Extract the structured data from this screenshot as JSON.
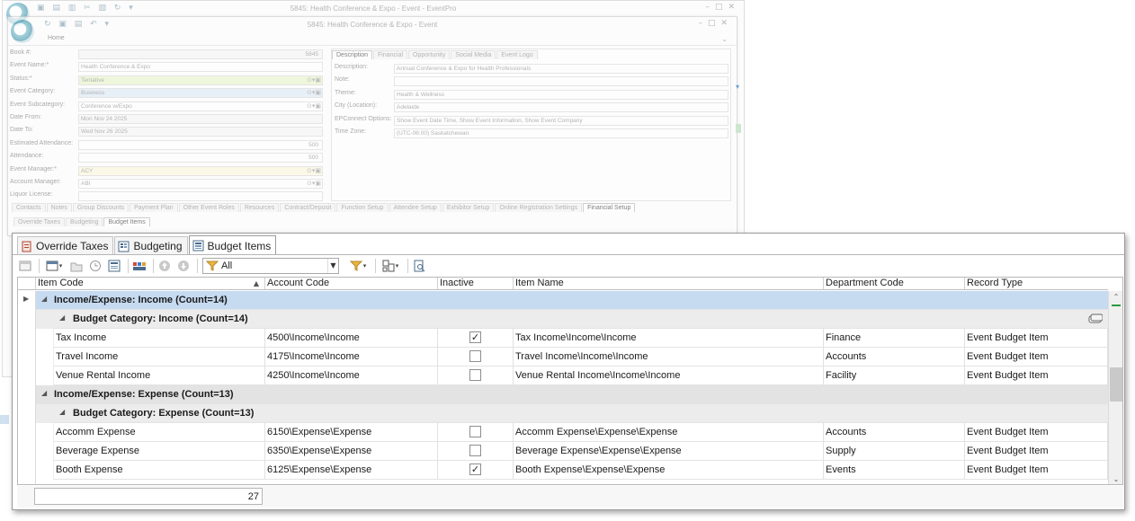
{
  "outer_window": {
    "title": "5845: Health Conference & Expo - Event - EventPro"
  },
  "inner_window": {
    "title": "5845: Health Conference & Expo - Event",
    "home_tab": "Home",
    "fields": [
      {
        "label": "Book #:",
        "value": "5845",
        "style": "ro"
      },
      {
        "label": "Event Name:*",
        "value": "Health Conference & Expo",
        "style": ""
      },
      {
        "label": "Status:*",
        "value": "Tentative",
        "style": "req"
      },
      {
        "label": "Event Category:",
        "value": "Business",
        "style": "blue"
      },
      {
        "label": "Event Subcategory:",
        "value": "Conference w/Expo",
        "style": ""
      },
      {
        "label": "Date From:",
        "value": "Mon Nov 24 2025",
        "style": "ro"
      },
      {
        "label": "Date To:",
        "value": "Wed Nov 26 2025",
        "style": "ro"
      },
      {
        "label": "Estimated Attendance:",
        "value": "500",
        "style": ""
      },
      {
        "label": "Attendance:",
        "value": "500",
        "style": ""
      },
      {
        "label": "Event Manager:*",
        "value": "ACY",
        "style": "yel"
      },
      {
        "label": "Account Manager:",
        "value": "ABI",
        "style": ""
      },
      {
        "label": "Liquor License:",
        "value": "",
        "style": ""
      }
    ],
    "desc_tabs": [
      "Description",
      "Financial",
      "Opportunity",
      "Social Media",
      "Event Logo"
    ],
    "desc_fields": [
      {
        "label": "Description:",
        "value": "Annual Conference & Expo for Health Professionals"
      },
      {
        "label": "Note:",
        "value": ""
      },
      {
        "label": "Theme:",
        "value": "Health & Wellness"
      },
      {
        "label": "City (Location):",
        "value": "Adelaide"
      },
      {
        "label": "EPConnect Options:",
        "value": "Show Event Date Time, Show Event Information, Show Event Company"
      },
      {
        "label": "Time Zone:",
        "value": "(UTC-06:00) Saskatchewan"
      }
    ],
    "bottom_tabs": [
      "Contacts",
      "Notes",
      "Group Discounts",
      "Payment Plan",
      "Other Event Roles",
      "Resources",
      "Contract/Deposit",
      "Function Setup",
      "Attendee Setup",
      "Exhibitor Setup",
      "Online Registration Settings",
      "Financial Setup"
    ],
    "sub_tabs": [
      "Override Taxes",
      "Budgeting",
      "Budget Items"
    ]
  },
  "panel": {
    "tabs": [
      {
        "label": "Override Taxes",
        "active": false
      },
      {
        "label": "Budgeting",
        "active": false
      },
      {
        "label": "Budget Items",
        "active": true
      }
    ],
    "filter_value": "All",
    "columns": [
      "Item Code",
      "Account Code",
      "Inactive",
      "Item Name",
      "Department Code",
      "Record Type"
    ],
    "groups": [
      {
        "label": "Income/Expense: Income (Count=14)",
        "category": "Budget Category: Income (Count=14)",
        "rows": [
          {
            "item_code": "Tax Income",
            "account_code": "4500\\Income\\Income",
            "inactive": true,
            "item_name": "Tax Income\\Income\\Income",
            "department_code": "Finance",
            "record_type": "Event Budget Item"
          },
          {
            "item_code": "Travel Income",
            "account_code": "4175\\Income\\Income",
            "inactive": false,
            "item_name": "Travel Income\\Income\\Income",
            "department_code": "Accounts",
            "record_type": "Event Budget Item"
          },
          {
            "item_code": "Venue Rental Income",
            "account_code": "4250\\Income\\Income",
            "inactive": false,
            "item_name": "Venue Rental Income\\Income\\Income",
            "department_code": "Facility",
            "record_type": "Event Budget Item"
          }
        ]
      },
      {
        "label": "Income/Expense: Expense (Count=13)",
        "category": "Budget Category: Expense (Count=13)",
        "rows": [
          {
            "item_code": "Accomm Expense",
            "account_code": "6150\\Expense\\Expense",
            "inactive": false,
            "item_name": "Accomm Expense\\Expense\\Expense",
            "department_code": "Accounts",
            "record_type": "Event Budget Item"
          },
          {
            "item_code": "Beverage Expense",
            "account_code": "6350\\Expense\\Expense",
            "inactive": false,
            "item_name": "Beverage Expense\\Expense\\Expense",
            "department_code": "Supply",
            "record_type": "Event Budget Item"
          },
          {
            "item_code": "Booth Expense",
            "account_code": "6125\\Expense\\Expense",
            "inactive": true,
            "item_name": "Booth Expense\\Expense\\Expense",
            "department_code": "Events",
            "record_type": "Event Budget Item"
          }
        ]
      }
    ],
    "total_count": "27"
  },
  "colors": {
    "selected_group": "#c6daf0",
    "group_bg": "#e3e3e3",
    "accent_green": "#2e9b3e"
  }
}
